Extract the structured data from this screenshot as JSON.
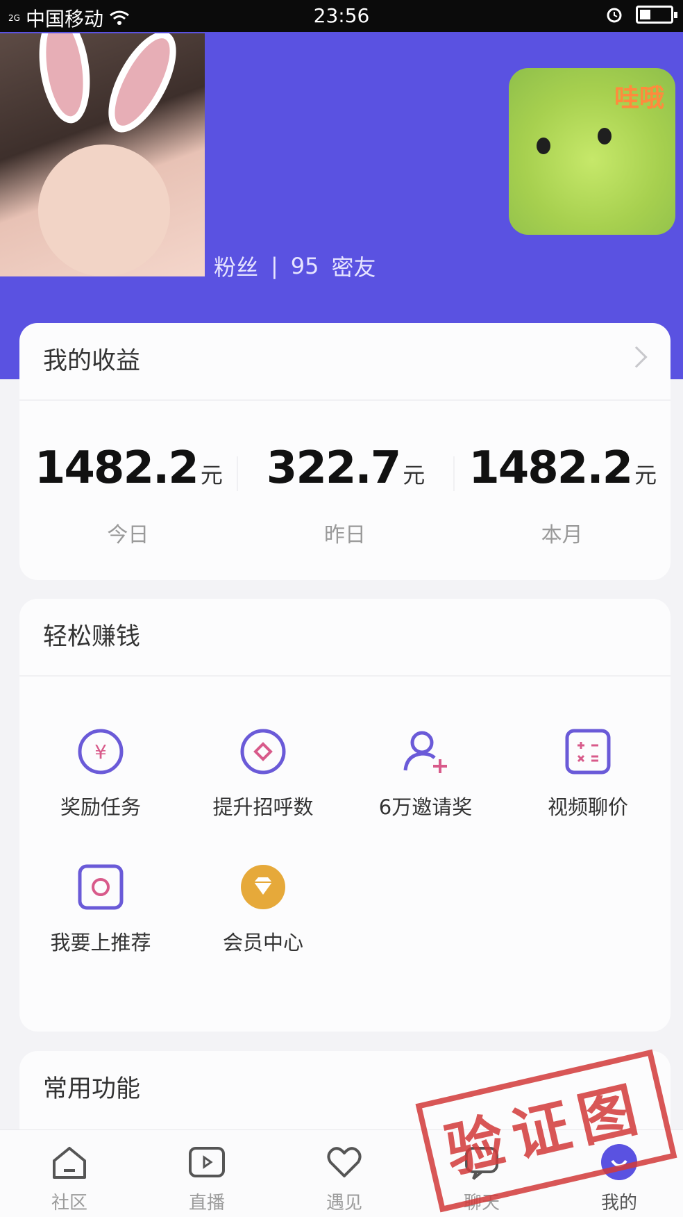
{
  "status": {
    "signal": "2G",
    "carrier": "中国移动",
    "time": "23:56"
  },
  "profile": {
    "fans_label": "粉丝",
    "separator": "|",
    "count": "95",
    "friends_label": "密友",
    "sticker_text": "哇哦"
  },
  "earnings": {
    "title": "我的收益",
    "items": [
      {
        "value": "1482.2",
        "unit": "元",
        "label": "今日"
      },
      {
        "value": "322.7",
        "unit": "元",
        "label": "昨日"
      },
      {
        "value": "1482.2",
        "unit": "元",
        "label": "本月"
      }
    ]
  },
  "tasks": {
    "title": "轻松赚钱",
    "items": [
      {
        "label": "奖励任务",
        "icon": "yuan-coin-icon"
      },
      {
        "label": "提升招呼数",
        "icon": "diamond-circle-icon"
      },
      {
        "label": "6万邀请奖",
        "icon": "add-user-icon"
      },
      {
        "label": "视频聊价",
        "icon": "calculator-icon"
      },
      {
        "label": "我要上推荐",
        "icon": "recommend-square-icon"
      },
      {
        "label": "会员中心",
        "icon": "gold-diamond-icon"
      }
    ]
  },
  "common": {
    "title": "常用功能"
  },
  "nav": {
    "tabs": [
      {
        "label": "社区",
        "icon": "home-icon"
      },
      {
        "label": "直播",
        "icon": "play-screen-icon"
      },
      {
        "label": "遇见",
        "icon": "heart-icon"
      },
      {
        "label": "聊天",
        "icon": "chat-icon"
      },
      {
        "label": "我的",
        "icon": "profile-icon"
      }
    ]
  },
  "watermark": {
    "text": "验证图"
  },
  "colors": {
    "brand": "#5a52e1",
    "accent": "#6a5ad8",
    "gold": "#e6a93a",
    "stamp": "#d23a3a"
  }
}
